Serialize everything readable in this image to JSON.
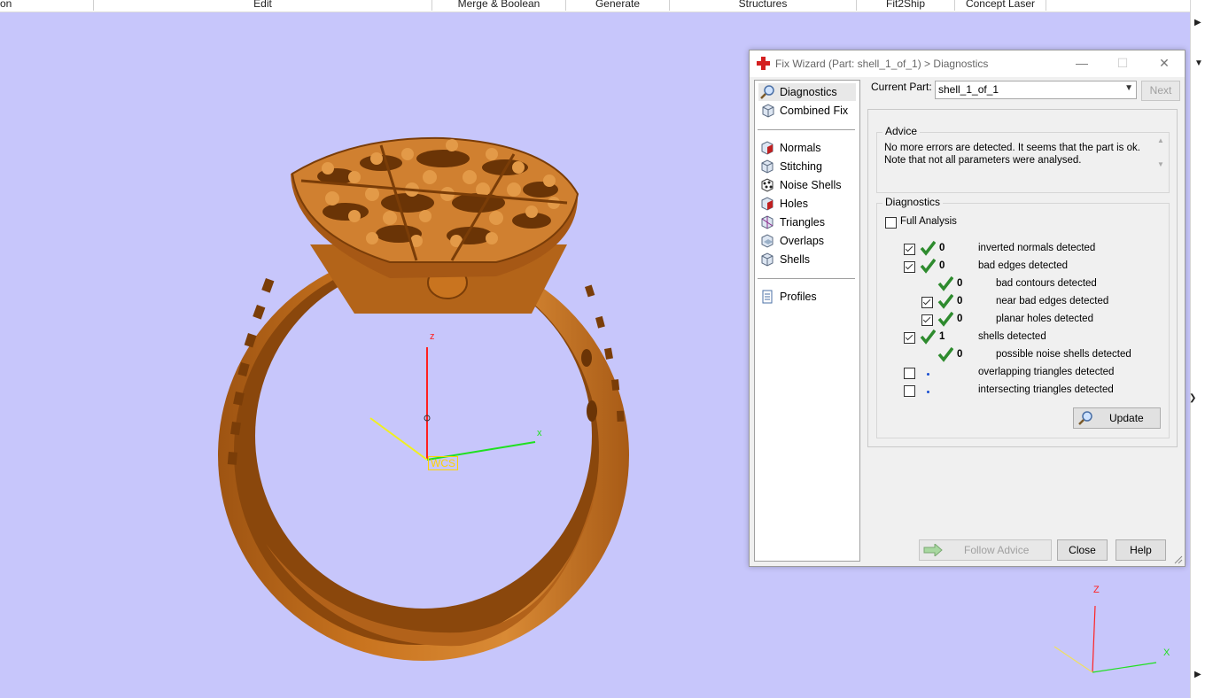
{
  "menubar": {
    "items": [
      "on",
      "Edit",
      "Merge & Boolean",
      "Generate",
      "Structures",
      "Fit2Ship",
      "Concept Laser"
    ]
  },
  "viewport": {
    "wcs_label": "WCS",
    "axis_z": "z",
    "axis_x": "x",
    "corner_axis_z": "Z",
    "corner_axis_x": "X",
    "background_color": "#c7c6fb",
    "model_color": "#c9741f"
  },
  "dialog": {
    "title": "Fix Wizard (Part: shell_1_of_1) > Diagnostics",
    "window_buttons": {
      "minimize": "—",
      "maximize": "☐",
      "close": "✕"
    },
    "nav": {
      "top_items": [
        {
          "label": "Diagnostics",
          "icon": "magnifier-icon",
          "selected": true
        },
        {
          "label": "Combined Fix",
          "icon": "cube-icon",
          "selected": false
        }
      ],
      "fix_items": [
        {
          "label": "Normals",
          "icon": "normals-cube-icon"
        },
        {
          "label": "Stitching",
          "icon": "stitching-cube-icon"
        },
        {
          "label": "Noise Shells",
          "icon": "noise-shells-icon"
        },
        {
          "label": "Holes",
          "icon": "holes-cube-icon"
        },
        {
          "label": "Triangles",
          "icon": "triangles-cube-icon"
        },
        {
          "label": "Overlaps",
          "icon": "overlaps-icon"
        },
        {
          "label": "Shells",
          "icon": "shells-cube-icon"
        }
      ],
      "profiles_label": "Profiles"
    },
    "current_part_label": "Current Part:",
    "current_part_value": "shell_1_of_1",
    "next_button": "Next",
    "advice": {
      "title": "Advice",
      "text": "No more errors are detected. It seems that the part is ok. Note that not all parameters were analysed."
    },
    "diagnostics": {
      "title": "Diagnostics",
      "full_analysis_label": "Full Analysis",
      "full_analysis_checked": false,
      "rows": [
        {
          "checked": true,
          "has_checkbox": true,
          "status": "tick",
          "count": "0",
          "label": "inverted normals detected",
          "indent": 0
        },
        {
          "checked": true,
          "has_checkbox": true,
          "status": "tick",
          "count": "0",
          "label": "bad edges detected",
          "indent": 0
        },
        {
          "checked": false,
          "has_checkbox": false,
          "status": "tick",
          "count": "0",
          "label": "bad contours detected",
          "indent": 1
        },
        {
          "checked": true,
          "has_checkbox": true,
          "status": "tick",
          "count": "0",
          "label": "near bad edges detected",
          "indent": 1
        },
        {
          "checked": true,
          "has_checkbox": true,
          "status": "tick",
          "count": "0",
          "label": "planar holes detected",
          "indent": 1
        },
        {
          "checked": true,
          "has_checkbox": true,
          "status": "tick",
          "count": "1",
          "label": "shells detected",
          "indent": 0
        },
        {
          "checked": false,
          "has_checkbox": false,
          "status": "tick",
          "count": "0",
          "label": "possible noise shells detected",
          "indent": 1
        },
        {
          "checked": false,
          "has_checkbox": true,
          "status": "dot",
          "count": "",
          "label": "overlapping triangles detected",
          "indent": 0
        },
        {
          "checked": false,
          "has_checkbox": true,
          "status": "dot",
          "count": "",
          "label": "intersecting triangles detected",
          "indent": 0
        }
      ],
      "update_button": "Update"
    },
    "footer": {
      "follow_advice": "Follow Advice",
      "close": "Close",
      "help": "Help"
    }
  }
}
